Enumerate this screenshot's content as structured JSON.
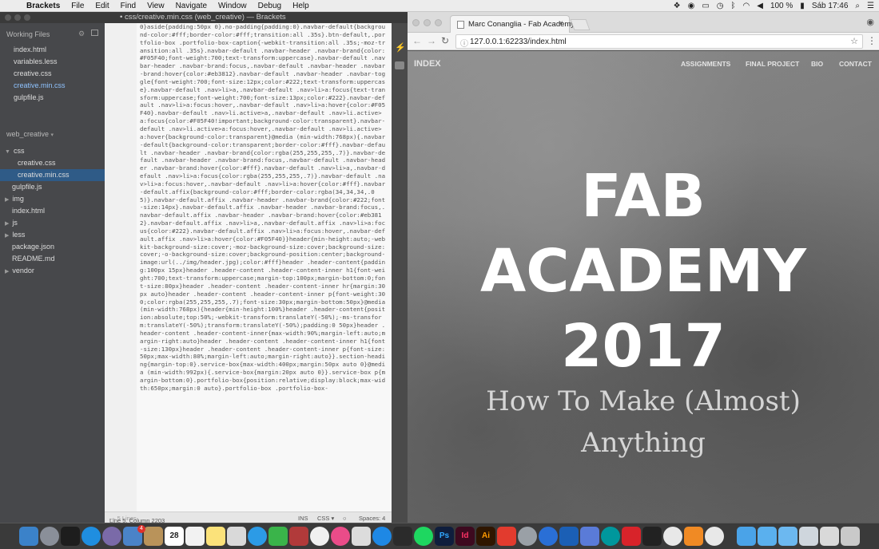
{
  "menubar": {
    "app": "Brackets",
    "items": [
      "File",
      "Edit",
      "Find",
      "View",
      "Navigate",
      "Window",
      "Debug",
      "Help"
    ],
    "battery": "100 %",
    "clock": "Sáb 17:46"
  },
  "brackets": {
    "window_title": "• css/creative.min.css (web_creative) — Brackets",
    "working_files_label": "Working Files",
    "working_files": [
      "index.html",
      "variables.less",
      "creative.css",
      "creative.min.css",
      "gulpfile.js"
    ],
    "project_name": "web_creative",
    "tree": [
      {
        "label": "css",
        "kind": "folder",
        "open": true
      },
      {
        "label": "creative.css",
        "kind": "file"
      },
      {
        "label": "creative.min.css",
        "kind": "file",
        "selected": true
      },
      {
        "label": "gulpfile.js",
        "kind": "file"
      },
      {
        "label": "img",
        "kind": "folder"
      },
      {
        "label": "index.html",
        "kind": "file"
      },
      {
        "label": "js",
        "kind": "folder"
      },
      {
        "label": "less",
        "kind": "folder"
      },
      {
        "label": "package.json",
        "kind": "file"
      },
      {
        "label": "README.md",
        "kind": "file"
      },
      {
        "label": "vendor",
        "kind": "folder"
      }
    ],
    "status": {
      "position": "Line 5, Column 2203",
      "lines": "— 5 Lines",
      "ins": "INS",
      "mode": "CSS",
      "spaces": "Spaces: 4"
    }
  },
  "code_text": "0}aside{padding:50px 0}.no-padding{padding:0}.navbar-default{background-color:#fff;border-color:#fff;transition:all .35s}.btn-default,.portfolio-box .portfolio-box-caption{-webkit-transition:all .35s;-moz-transition:all .35s}.navbar-default .navbar-header .navbar-brand{color:#F05F40;font-weight:700;text-transform:uppercase}.navbar-default .navbar-header .navbar-brand:focus,.navbar-default .navbar-header .navbar-brand:hover{color:#eb3812}.navbar-default .navbar-header .navbar-toggle{font-weight:700;font-size:12px;color:#222;text-transform:uppercase}.navbar-default .nav>li>a,.navbar-default .nav>li>a:focus{text-transform:uppercase;font-weight:700;font-size:13px;color:#222}.navbar-default .nav>li>a:focus:hover,.navbar-default .nav>li>a:hover{color:#F05F40}.navbar-default .nav>li.active>a,.navbar-default .nav>li.active>a:focus{color:#F05F40!important;background-color:transparent}.navbar-default .nav>li.active>a:focus:hover,.navbar-default .nav>li.active>a:hover{background-color:transparent}@media (min-width:768px){.navbar-default{background-color:transparent;border-color:#fff}.navbar-default .navbar-header .navbar-brand{color:rgba(255,255,255,.7)}.navbar-default .navbar-header .navbar-brand:focus,.navbar-default .navbar-header .navbar-brand:hover{color:#fff}.navbar-default .nav>li>a,.navbar-default .nav>li>a:focus{color:rgba(255,255,255,.7)}.navbar-default .nav>li>a:focus:hover,.navbar-default .nav>li>a:hover{color:#fff}.navbar-default.affix{background-color:#fff;border-color:rgba(34,34,34,.05)}.navbar-default.affix .navbar-header .navbar-brand{color:#222;font-size:14px}.navbar-default.affix .navbar-header .navbar-brand:focus,.navbar-default.affix .navbar-header .navbar-brand:hover{color:#eb3812}.navbar-default.affix .nav>li>a,.navbar-default.affix .nav>li>a:focus{color:#222}.navbar-default.affix .nav>li>a:focus:hover,.navbar-default.affix .nav>li>a:hover{color:#F05F40}}header{min-height:auto;-webkit-background-size:cover;-moz-background-size:cover;background-size:cover;-o-background-size:cover;background-position:center;background-image:url(../img/header.jpg);color:#fff}header .header-content{padding:100px 15px}header .header-content .header-content-inner h1{font-weight:700;text-transform:uppercase;margin-top:100px;margin-bottom:0;font-size:80px}header .header-content .header-content-inner hr{margin:30px auto}header .header-content .header-content-inner p{font-weight:300;color:rgba(255,255,255,.7);font-size:30px;margin-bottom:50px}@media (min-width:768px){header{min-height:100%}header .header-content{position:absolute;top:50%;-webkit-transform:translateY(-50%);-ms-transform:translateY(-50%);transform:translateY(-50%);padding:0 50px}header .header-content .header-content-inner{max-width:90%;margin-left:auto;margin-right:auto}header .header-content .header-content-inner h1{font-size:130px}header .header-content .header-content-inner p{font-size:50px;max-width:80%;margin-left:auto;margin-right:auto}}.section-heading{margin-top:0}.service-box{max-width:400px;margin:50px auto 0}@media (min-width:992px){.service-box{margin:20px auto 0}}.service-box p{margin-bottom:0}.portfolio-box{position:relative;display:block;max-width:650px;margin:0 auto}.portfolio-box .portfolio-box-",
  "browser": {
    "tab_title": "Marc Conanglia - Fab Academy",
    "tab_close": "×",
    "url": "127.0.0.1:62233/index.html",
    "site": {
      "brand": "Index",
      "nav": [
        "Assignments",
        "Final Project",
        "Bio",
        "Contact"
      ],
      "headline": [
        "FAB",
        "ACADEMY",
        "2017"
      ],
      "subline": "How To Make (Almost) Anything"
    }
  },
  "dock": {
    "calendar_day": "28",
    "badge_count": "4",
    "apps": [
      "Ps",
      "Id",
      "Ai"
    ]
  },
  "colors": {
    "accent": "#F05F40",
    "sidebar_bg": "#47484b",
    "selection": "#2f5b87"
  }
}
